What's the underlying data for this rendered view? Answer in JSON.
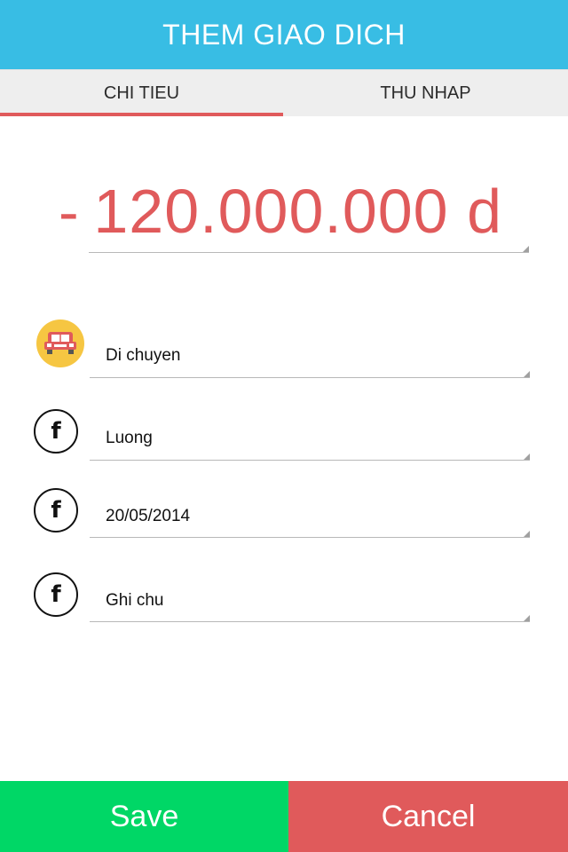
{
  "header": {
    "title": "THEM GIAO DICH"
  },
  "tabs": [
    {
      "label": "CHI TIEU",
      "active": true
    },
    {
      "label": "THU NHAP",
      "active": false
    }
  ],
  "amount": {
    "sign": "-",
    "value": "120.000.000 d"
  },
  "fields": [
    {
      "value": "Di chuyen",
      "icon": "car-icon"
    },
    {
      "value": "Luong",
      "icon": "facebook-icon"
    },
    {
      "value": "20/05/2014",
      "icon": "facebook-icon"
    },
    {
      "value": "Ghi chu",
      "icon": "facebook-icon"
    }
  ],
  "actions": {
    "save_label": "Save",
    "cancel_label": "Cancel"
  },
  "colors": {
    "header_bg": "#38bde4",
    "accent_red": "#e05a5b",
    "save_green": "#00d766",
    "tab_bg": "#eeeeee",
    "car_icon_bg": "#f6c642"
  }
}
